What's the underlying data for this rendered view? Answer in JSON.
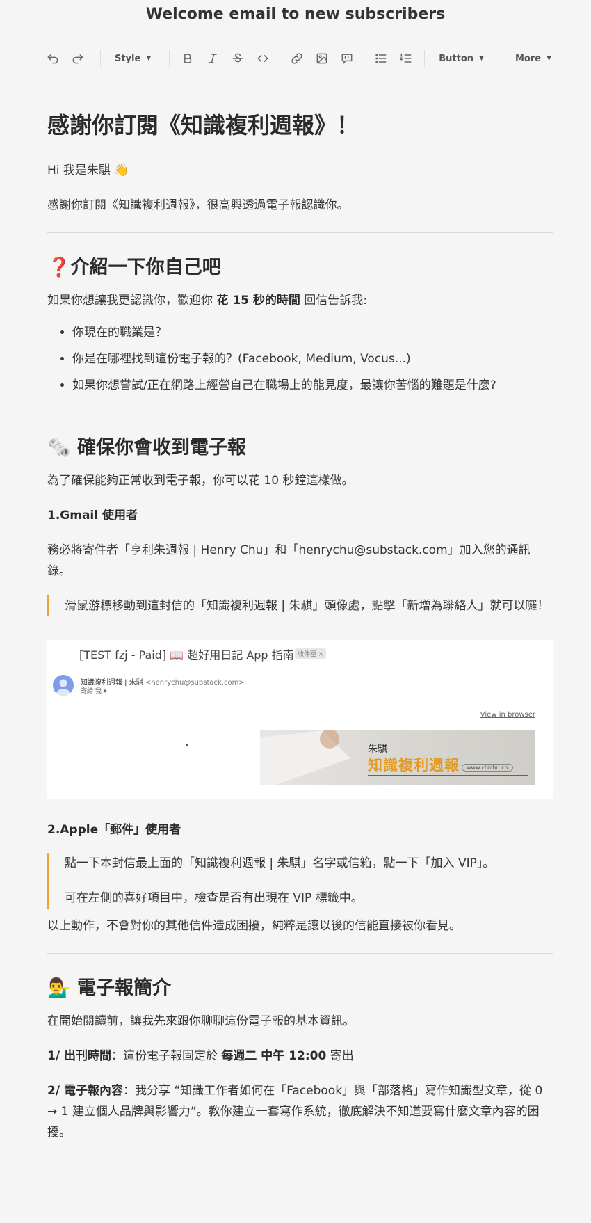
{
  "window": {
    "title": "Welcome email to new subscribers"
  },
  "toolbar": {
    "style_label": "Style",
    "button_label": "Button",
    "more_label": "More"
  },
  "doc": {
    "title": "感謝你訂閱《知識複利週報》！",
    "greeting": "Hi 我是朱騏 👋",
    "intro": "感謝你訂閱《知識複利週報》，很高興透過電子報認識你。",
    "s1": {
      "heading": "❓介紹一下你自己吧",
      "lead_pre": "如果你想讓我更認識你，歡迎你 ",
      "lead_bold": "花 15 秒的時間",
      "lead_post": " 回信告訴我:",
      "questions": [
        "你現在的職業是？",
        "你是在哪裡找到這份電子報的？(Facebook, Medium, Vocus...)",
        "如果你想嘗試/正在網路上經營自己在職場上的能見度，最讓你苦惱的難題是什麼?"
      ]
    },
    "s2": {
      "heading": "🗞️ 確保你會收到電子報",
      "intro": "為了確保能夠正常收到電子報，你可以花 10 秒鐘這樣做。",
      "gmail_title": "1.Gmail 使用者",
      "gmail_text": "務必將寄件者「亨利朱週報 | Henry Chu」和「henrychu@substack.com」加入您的通訊錄。",
      "gmail_quote": "滑鼠游標移動到這封信的「知識複利週報 | 朱騏」頭像處，點擊「新增為聯絡人」就可以囉！",
      "screenshot": {
        "subject": "[TEST fzj - Paid] 📖 超好用日記 App 指南",
        "tag": "收件匣 ×",
        "sender_name": "知識複利週報 | 朱騏",
        "sender_addr": "<henrychu@substack.com>",
        "to": "寄給 我 ▾",
        "view_link": "View in browser",
        "banner_name": "朱騏",
        "banner_title": "知識複利週報",
        "banner_url": "www.chichu.co"
      },
      "apple_title": "2.Apple「郵件」使用者",
      "apple_quote_1": "點一下本封信最上面的「知識複利週報 | 朱騏」名字或信箱，點一下「加入 VIP」。",
      "apple_quote_2": "可在左側的喜好項目中，檢查是否有出現在 VIP 標籤中。",
      "outro": "以上動作，不會對你的其他信件造成困擾，純粹是讓以後的信能直接被你看見。"
    },
    "s3": {
      "heading": "💁‍♂️ 電子報簡介",
      "intro": "在開始閱讀前，讓我先來跟你聊聊這份電子報的基本資訊。",
      "item1_label": "1/ 出刊時間",
      "item1_pre": "：這份電子報固定於 ",
      "item1_bold": "每週二 中午 12:00",
      "item1_post": " 寄出",
      "item2_label": "2/ 電子報內容",
      "item2_text": "：我分享 “知識工作者如何在「Facebook」與「部落格」寫作知識型文章，從 0 → 1 建立個人品牌與影響力”。教你建立一套寫作系統，徹底解決不知道要寫什麼文章內容的困擾。"
    }
  }
}
